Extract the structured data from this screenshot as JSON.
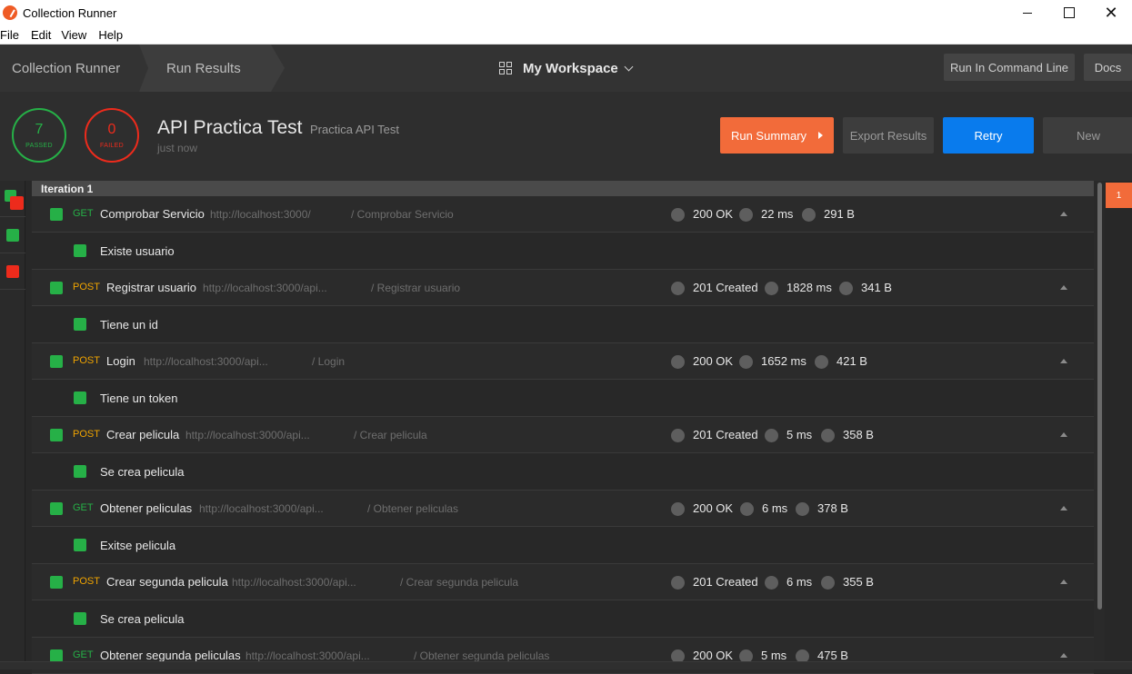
{
  "window": {
    "title": "Collection Runner"
  },
  "menu": [
    "File",
    "Edit",
    "View",
    "Help"
  ],
  "header": {
    "breadcrumb": [
      "Collection Runner",
      "Run Results"
    ],
    "workspace": "My Workspace",
    "run_cli": "Run In Command Line",
    "docs": "Docs"
  },
  "summary": {
    "passed_count": "7",
    "passed_label": "PASSED",
    "failed_count": "0",
    "failed_label": "FAILED",
    "collection_name": "API Practica Test",
    "environment": "Practica API Test",
    "time": "just now",
    "run_summary": "Run Summary",
    "export": "Export Results",
    "retry": "Retry",
    "new": "New"
  },
  "colors": {
    "accent": "#f26b3a",
    "primary": "#097bed",
    "pass": "#26b047",
    "fail": "#ed2b1c",
    "get": "#26b047",
    "post": "#f0a400"
  },
  "iteration": {
    "label": "Iteration 1"
  },
  "requests": [
    {
      "method": "GET",
      "name": "Comprobar Servicio",
      "url": "http://localhost:3000/",
      "path": "/ Comprobar Servicio",
      "status": "200 OK",
      "time": "22 ms",
      "size": "291 B",
      "test": "Existe usuario"
    },
    {
      "method": "POST",
      "name": "Registrar usuario",
      "url": "http://localhost:3000/api...",
      "path": "/ Registrar usuario",
      "status": "201 Created",
      "time": "1828 ms",
      "size": "341 B",
      "test": "Tiene un id"
    },
    {
      "method": "POST",
      "name": "Login",
      "url": "http://localhost:3000/api...",
      "path": "/ Login",
      "status": "200 OK",
      "time": "1652 ms",
      "size": "421 B",
      "test": "Tiene un token"
    },
    {
      "method": "POST",
      "name": "Crear pelicula",
      "url": "http://localhost:3000/api...",
      "path": "/ Crear pelicula",
      "status": "201 Created",
      "time": "5 ms",
      "size": "358 B",
      "test": "Se crea pelicula"
    },
    {
      "method": "GET",
      "name": "Obtener peliculas",
      "url": "http://localhost:3000/api...",
      "path": "/ Obtener peliculas",
      "status": "200 OK",
      "time": "6 ms",
      "size": "378 B",
      "test": "Exitse pelicula"
    },
    {
      "method": "POST",
      "name": "Crear segunda pelicula",
      "url": "http://localhost:3000/api...",
      "path": "/ Crear segunda pelicula",
      "status": "201 Created",
      "time": "6 ms",
      "size": "355 B",
      "test": "Se crea pelicula"
    },
    {
      "method": "GET",
      "name": "Obtener segunda peliculas",
      "url": "http://localhost:3000/api...",
      "path": "/ Obtener segunda peliculas",
      "status": "200 OK",
      "time": "5 ms",
      "size": "475 B",
      "test": ""
    }
  ],
  "minimap": {
    "badge": "1"
  }
}
